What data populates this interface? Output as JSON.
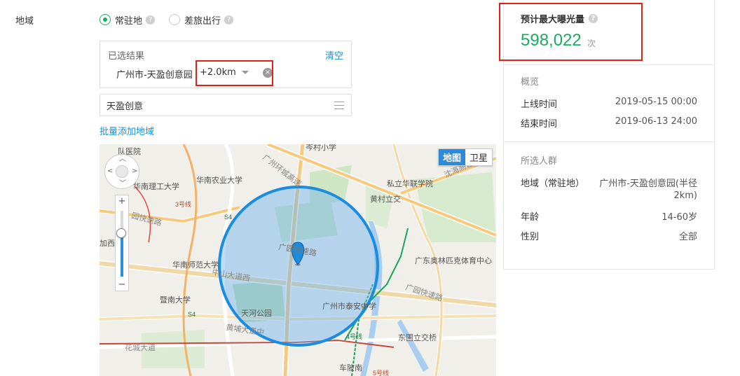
{
  "region": {
    "label": "地域",
    "options": [
      {
        "label": "常驻地",
        "selected": true
      },
      {
        "label": "差旅出行",
        "selected": false
      }
    ],
    "help_glyph": "?"
  },
  "selected_result": {
    "title": "已选结果",
    "clear_label": "清空",
    "place": "广州市-天盈创意园",
    "radius": "+2.0km",
    "remove_glyph": "×"
  },
  "search": {
    "value": "天盈创意",
    "icon": "list-icon"
  },
  "bulk_add_label": "批量添加地域",
  "map": {
    "type_tabs": [
      "地图",
      "卫星"
    ],
    "active_tab": "地图",
    "zoom_plus": "+",
    "zoom_minus": "−",
    "labels": {
      "l1": "队医院",
      "l2": "岑村小学",
      "l3": "广州环城高速",
      "l4": "私立华联学院",
      "l5": "沈海高速",
      "l6": "华南农业大学",
      "l7": "华南理工大学",
      "l8": "3号线",
      "l9": "黄村立交",
      "l10": "园快速路",
      "l11": "S4",
      "l12": "加西",
      "l13": "华南师范大学",
      "l14": "中山大道西",
      "l15": "广园快速路",
      "l16": "广东奥林匹克体育中心",
      "l17": "暨南大学",
      "l18": "天河公园",
      "l19": "广州市泰安中学",
      "l20": "黄埔大道中",
      "l21": "4号线",
      "l22": "东圃立交桥",
      "l23": "花城大道",
      "l24": "车陂南",
      "l25": "5号线",
      "l26": "S4",
      "l27": "广园快速路"
    }
  },
  "exposure": {
    "title": "预计最大曝光量",
    "value": "598,022",
    "unit": "次"
  },
  "overview": {
    "title": "概览",
    "rows": [
      {
        "label": "上线时间",
        "value": "2019-05-15 00:00"
      },
      {
        "label": "结束时间",
        "value": "2019-06-13 24:00"
      }
    ]
  },
  "audience": {
    "title": "所选人群",
    "rows": [
      {
        "label": "地域（常驻地）",
        "value_line1": "广州市-天盈创意园(半径",
        "value_line2": "2km)"
      },
      {
        "label": "年龄",
        "value": "14-60岁"
      },
      {
        "label": "性别",
        "value": "全部"
      }
    ]
  },
  "colors": {
    "accent_green": "#1aad5e",
    "link_blue": "#1890d4",
    "highlight_red": "#e0201a",
    "map_circle": "#1a8de0"
  }
}
